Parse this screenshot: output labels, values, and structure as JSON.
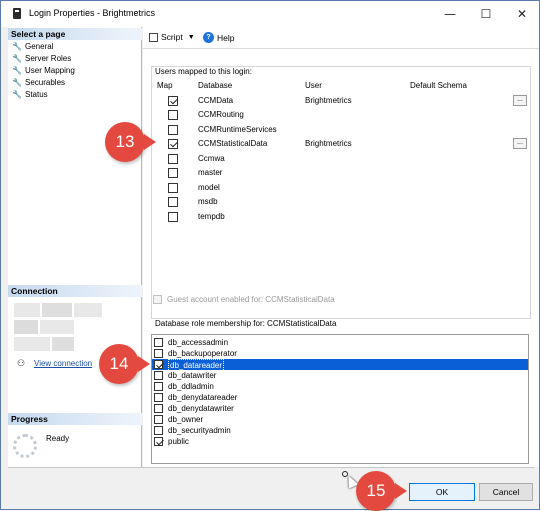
{
  "window": {
    "title": "Login Properties - Brightmetrics",
    "minimize": "—",
    "maximize": "☐",
    "close": "✕"
  },
  "left": {
    "select_page_heading": "Select a page",
    "pages": [
      "General",
      "Server Roles",
      "User Mapping",
      "Securables",
      "Status"
    ],
    "connection_heading": "Connection",
    "view_connection_link": "View connection",
    "progress_heading": "Progress",
    "progress_status": "Ready"
  },
  "toolbar": {
    "script_label": "Script",
    "help_label": "Help"
  },
  "users_mapped": {
    "label": "Users mapped to this login:",
    "columns": [
      "Map",
      "Database",
      "User",
      "Default Schema"
    ],
    "rows": [
      {
        "checked": true,
        "database": "CCMData",
        "user": "Brightmetrics",
        "schema": ""
      },
      {
        "checked": false,
        "database": "CCMRouting",
        "user": "",
        "schema": ""
      },
      {
        "checked": false,
        "database": "CCMRuntimeServices",
        "user": "",
        "schema": ""
      },
      {
        "checked": true,
        "database": "CCMStatisticalData",
        "user": "Brightmetrics",
        "schema": ""
      },
      {
        "checked": false,
        "database": "Ccmwa",
        "user": "",
        "schema": ""
      },
      {
        "checked": false,
        "database": "master",
        "user": "",
        "schema": ""
      },
      {
        "checked": false,
        "database": "model",
        "user": "",
        "schema": ""
      },
      {
        "checked": false,
        "database": "msdb",
        "user": "",
        "schema": ""
      },
      {
        "checked": false,
        "database": "tempdb",
        "user": "",
        "schema": ""
      }
    ],
    "ellipsis": "..."
  },
  "guest_label": "Guest account enabled for: CCMStatisticalData",
  "role_membership": {
    "label": "Database role membership for: CCMStatisticalData",
    "roles": [
      {
        "name": "db_accessadmin",
        "checked": false,
        "selected": false
      },
      {
        "name": "db_backupoperator",
        "checked": false,
        "selected": false
      },
      {
        "name": "db_datareader",
        "checked": true,
        "selected": true
      },
      {
        "name": "db_datawriter",
        "checked": false,
        "selected": false
      },
      {
        "name": "db_ddladmin",
        "checked": false,
        "selected": false
      },
      {
        "name": "db_denydatareader",
        "checked": false,
        "selected": false
      },
      {
        "name": "db_denydatawriter",
        "checked": false,
        "selected": false
      },
      {
        "name": "db_owner",
        "checked": false,
        "selected": false
      },
      {
        "name": "db_securityadmin",
        "checked": false,
        "selected": false
      },
      {
        "name": "public",
        "checked": true,
        "selected": false
      }
    ]
  },
  "buttons": {
    "ok": "OK",
    "cancel": "Cancel"
  },
  "callouts": {
    "a": "13",
    "b": "14",
    "c": "15"
  },
  "colors": {
    "callout": "#e4493f",
    "selection": "#0a5fd6",
    "link": "#1b4ea8"
  }
}
